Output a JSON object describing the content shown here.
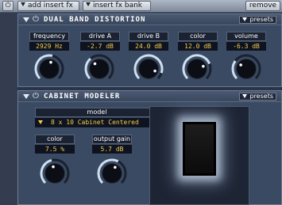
{
  "toolbar": {
    "power_label": "⏻",
    "add_insert_label": "add insert fx",
    "insert_bank_label": "insert fx bank",
    "remove_label": "remove"
  },
  "distortion": {
    "title": "DUAL BAND DISTORTION",
    "presets_label": "presets",
    "params": [
      {
        "label": "frequency",
        "value": "2929 Hz",
        "level": 0.55
      },
      {
        "label": "drive A",
        "value": "-2.7 dB",
        "level": 0.35
      },
      {
        "label": "drive B",
        "value": "24.0 dB",
        "level": 0.9
      },
      {
        "label": "color",
        "value": "12.0 dB",
        "level": 0.75
      },
      {
        "label": "volume",
        "value": "-6.3 dB",
        "level": 0.3
      }
    ]
  },
  "cabinet": {
    "title": "CABINET MODELER",
    "presets_label": "presets",
    "model_label": "model",
    "model_value": "8 x 10 Cabinet Centered",
    "params": [
      {
        "label": "color",
        "value": "7.5 %",
        "level": 0.45
      },
      {
        "label": "output gain",
        "value": "5.7 dB",
        "level": 0.6
      }
    ]
  },
  "colors": {
    "panel": "#3a4a62",
    "value_text": "#f0cd4b",
    "knob_arc": "#cfe0f2"
  }
}
